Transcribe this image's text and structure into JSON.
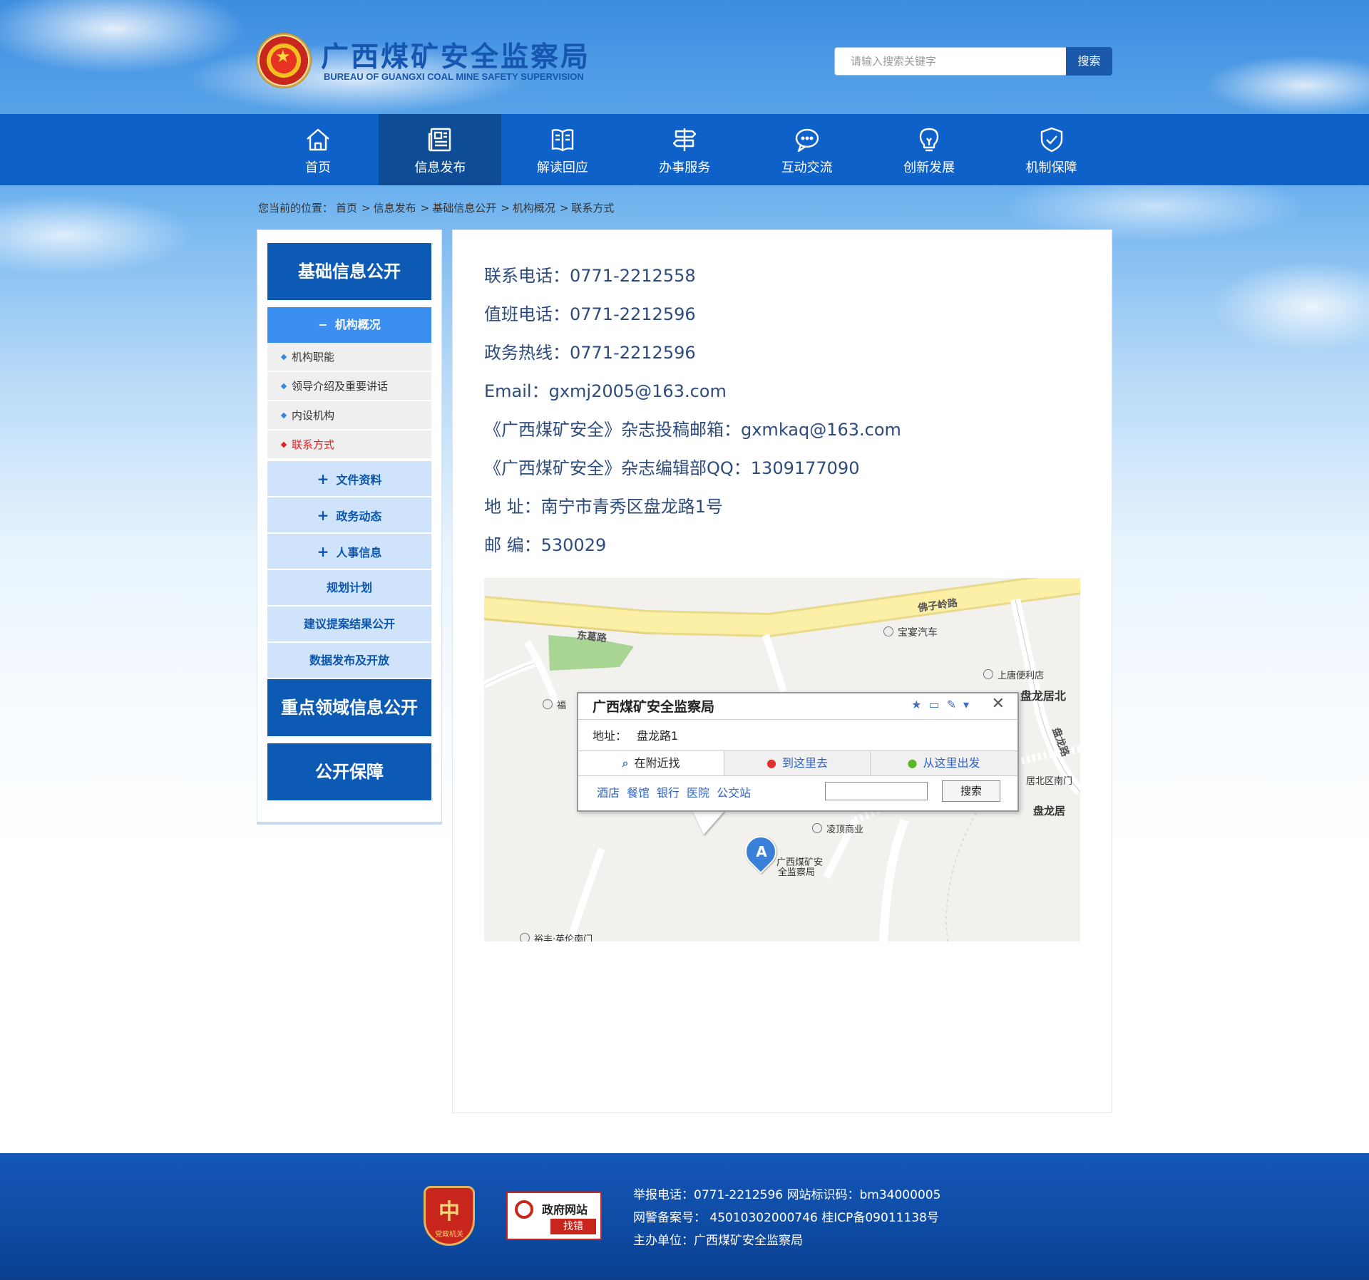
{
  "header": {
    "logo_cn": "广西煤矿安全监察局",
    "logo_en": "BUREAU OF GUANGXI COAL MINE SAFETY SUPERVISION",
    "search_placeholder": "请输入搜索关键字",
    "search_button": "搜索"
  },
  "nav": {
    "items": [
      {
        "label": "首页",
        "icon": "home-icon"
      },
      {
        "label": "信息发布",
        "icon": "newspaper-icon"
      },
      {
        "label": "解读回应",
        "icon": "book-icon"
      },
      {
        "label": "办事服务",
        "icon": "signpost-icon"
      },
      {
        "label": "互动交流",
        "icon": "chat-icon"
      },
      {
        "label": "创新发展",
        "icon": "lightbulb-icon"
      },
      {
        "label": "机制保障",
        "icon": "shield-icon"
      }
    ],
    "active_index": 1
  },
  "breadcrumb": {
    "prefix": "您当前的位置：",
    "items": [
      "首页",
      "信息发布",
      "基础信息公开",
      "机构概况",
      "联系方式"
    ]
  },
  "sidebar": {
    "head1": "基础信息公开",
    "sub_open": "机构概况",
    "leaves": [
      "机构职能",
      "领导介绍及重要讲话",
      "内设机构",
      "联系方式"
    ],
    "items": [
      {
        "label": "文件资料",
        "plus": true
      },
      {
        "label": "政务动态",
        "plus": true
      },
      {
        "label": "人事信息",
        "plus": true
      },
      {
        "label": "规划计划",
        "plus": false
      },
      {
        "label": "建议提案结果公开",
        "plus": false
      },
      {
        "label": "数据发布及开放",
        "plus": false
      }
    ],
    "head2": "重点领域信息公开",
    "head3": "公开保障"
  },
  "contact": {
    "lines": [
      "联系电话：0771-2212558",
      "值班电话：0771-2212596",
      "政务热线：0771-2212596",
      "Email：gxmj2005@163.com",
      "《广西煤矿安全》杂志投稿邮箱：gxmkaq@163.com",
      "《广西煤矿安全》杂志编辑部QQ：1309177090",
      "地  址：南宁市青秀区盘龙路1号",
      "邮  编：530029"
    ]
  },
  "map": {
    "roads": [
      "佛子岭路",
      "东葛路",
      "盘龙路"
    ],
    "pois": [
      "宝宴汽车",
      "上唐便利店",
      "盘龙居北",
      "居北区南门",
      "盘龙居",
      "凌顶商业",
      "裕丰·英伦南门",
      "福"
    ],
    "marker_letter": "A",
    "marker_label_1": "广西煤矿安",
    "marker_label_2": "全监察局",
    "popup": {
      "title": "广西煤矿安全监察局",
      "address_label": "地址：",
      "address": "盘龙路1",
      "tabs": [
        "在附近找",
        "到这里去",
        "从这里出发"
      ],
      "links": [
        "酒店",
        "餐馆",
        "银行",
        "医院",
        "公交站"
      ],
      "search_button": "搜索"
    }
  },
  "footer": {
    "badge1_line": "党政机关",
    "badge2_line1": "政府网站",
    "badge2_line2": "找错",
    "line1": "举报电话：0771-2212596    网站标识码：bm34000005",
    "line2": "网警备案号：  45010302000746     桂ICP备09011138号",
    "line3": "主办单位：广西煤矿安全监察局"
  }
}
